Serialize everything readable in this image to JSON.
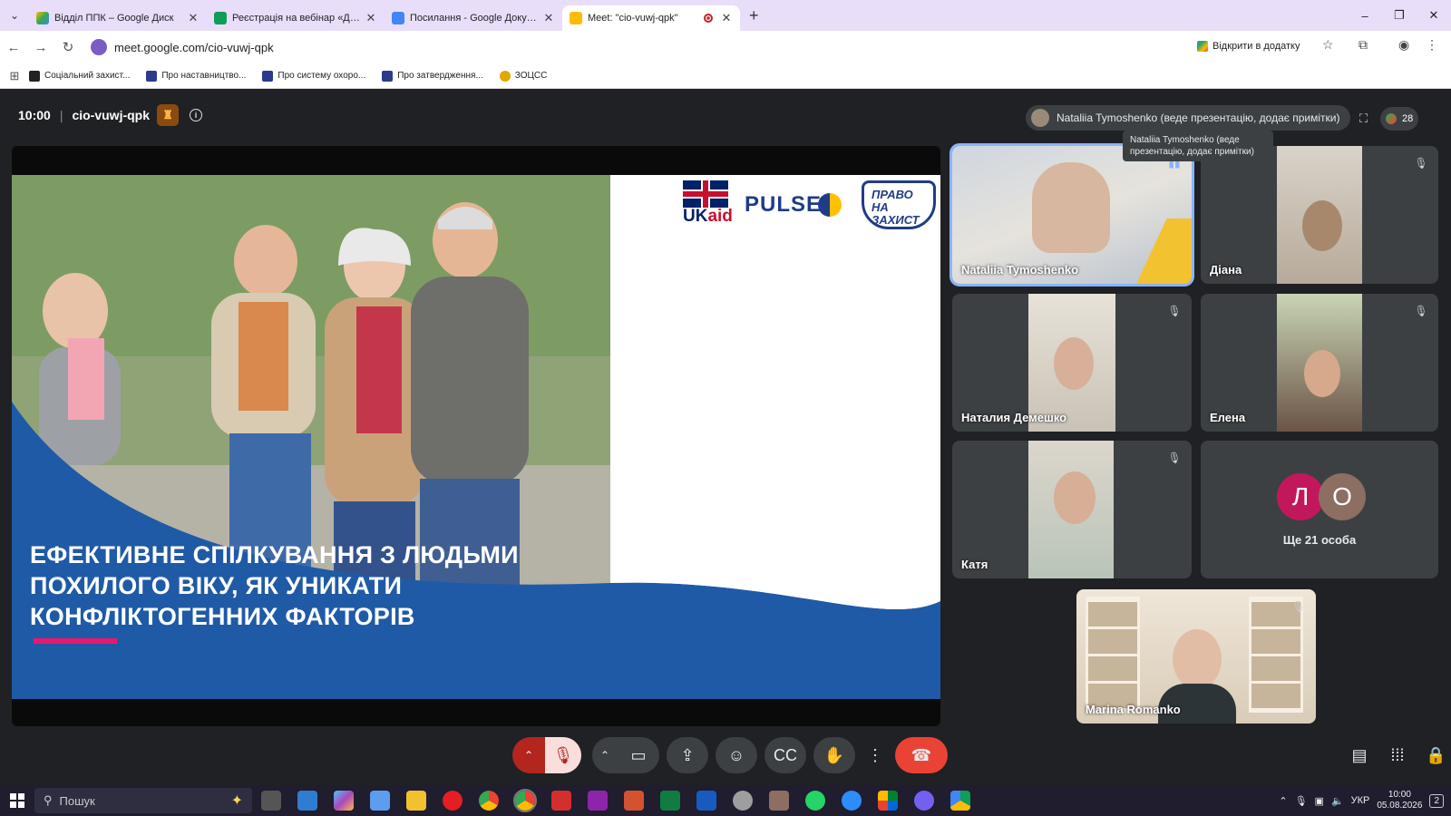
{
  "browser": {
    "tabs": [
      {
        "label": "Відділ ППК – Google Диск",
        "color": "#1a73e8",
        "active": false
      },
      {
        "label": "Реєстрація на вебінар «Догляд",
        "color": "#0f9d58",
        "active": false
      },
      {
        "label": "Посилання - Google Докумен",
        "color": "#4285f4",
        "active": false
      },
      {
        "label": "Meet: \"cio-vuwj-qpk\"",
        "color": "#fbbc04",
        "active": true
      }
    ],
    "url": "meet.google.com/cio-vuwj-qpk",
    "open_in_app_label": "Відкрити в додатку",
    "bookmarks": [
      {
        "label": "Соціальний захист...",
        "color": "#222"
      },
      {
        "label": "Про наставництво...",
        "color": "#2b3a8c"
      },
      {
        "label": "Про систему охоро...",
        "color": "#2b3a8c"
      },
      {
        "label": "Про затвердження...",
        "color": "#2b3a8c"
      },
      {
        "label": "ЗОЦСС",
        "color": "#e0a800"
      }
    ]
  },
  "meet": {
    "time": "10:00",
    "meeting_code": "cio-vuwj-qpk",
    "presenter_pill": "Nataliia Tymoshenko (веде презентацію, додає примітки)",
    "tooltip": "Nataliia Tymoshenko (веде презентацію, додає примітки)",
    "participant_count": "28",
    "slide": {
      "title_lines": [
        "ЕФЕКТИВНЕ СПІЛКУВАННЯ З ЛЮДЬМИ",
        "ПОХИЛОГО ВІКУ, ЯК УНИКАТИ",
        "КОНФЛІКТОГЕННИХ ФАКТОРІВ"
      ],
      "logo_ukaid": "UK",
      "logo_ukaid_b": "aid",
      "logo_pulse": "PULSE",
      "logo_pravo": "ПРАВО НА ЗАХИСТ"
    },
    "tiles": [
      {
        "name": "Nataliia Tymoshenko"
      },
      {
        "name": "Діана"
      },
      {
        "name": "Наталия Демешко"
      },
      {
        "name": "Елена"
      },
      {
        "name": "Катя"
      },
      {
        "name": "Marina Romanko"
      }
    ],
    "more": {
      "avatars": [
        {
          "letter": "Л",
          "color": "#c2185b"
        },
        {
          "letter": "О",
          "color": "#8d6e63"
        }
      ],
      "label": "Ще 21 особа"
    }
  },
  "taskbar": {
    "search_placeholder": "Пошук",
    "language": "УКР",
    "clock_time": "10:00",
    "clock_date": "05.08.2026",
    "notification_count": "2"
  }
}
